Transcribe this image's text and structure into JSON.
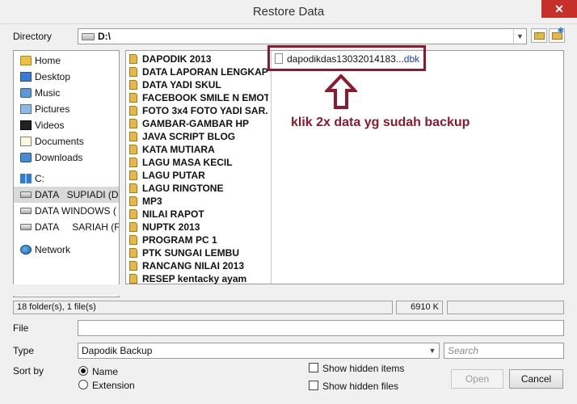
{
  "window": {
    "title": "Restore Data",
    "close_glyph": "✕"
  },
  "directory": {
    "label": "Directory",
    "path": "D:\\",
    "arrow_glyph": "▼"
  },
  "nav": {
    "items": [
      {
        "label": "Home",
        "icon": "home-icon"
      },
      {
        "label": "Desktop",
        "icon": "desktop-icon"
      },
      {
        "label": "Music",
        "icon": "music-icon"
      },
      {
        "label": "Pictures",
        "icon": "pictures-icon"
      },
      {
        "label": "Videos",
        "icon": "videos-icon"
      },
      {
        "label": "Documents",
        "icon": "documents-icon"
      },
      {
        "label": "Downloads",
        "icon": "downloads-icon"
      },
      {
        "label": "C:",
        "icon": "windows-drive-icon"
      },
      {
        "label": "DATA   SUPIADI (D",
        "icon": "drive-icon",
        "selected": true
      },
      {
        "label": "DATA WINDOWS (",
        "icon": "drive-icon"
      },
      {
        "label": "DATA     SARIAH (F",
        "icon": "drive-icon"
      },
      {
        "label": "Network",
        "icon": "network-icon"
      }
    ]
  },
  "folders": [
    "DAPODIK 2013",
    "DATA LAPORAN LENGKAP",
    "DATA YADI SKUL",
    "FACEBOOK SMILE N EMOT...",
    "FOTO 3x4 FOTO YADI SAR...",
    "GAMBAR-GAMBAR HP",
    "JAVA SCRIPT BLOG",
    "KATA MUTIARA",
    "LAGU MASA KECIL",
    "LAGU PUTAR",
    "LAGU RINGTONE",
    "MP3",
    "NILAI RAPOT",
    "NUPTK 2013",
    "PROGRAM PC 1",
    "PTK SUNGAI LEMBU",
    "RANCANG NILAI 2013",
    "RESEP kentacky ayam"
  ],
  "file": {
    "name": "dapodikdas13032014183...",
    "ext": "dbk"
  },
  "annotation": {
    "text": "klik 2x data yg sudah backup",
    "color": "#8b1a2e"
  },
  "status": {
    "summary": "18 folder(s), 1 file(s)",
    "size": "6910 K"
  },
  "form": {
    "file_label": "File",
    "file_value": "",
    "type_label": "Type",
    "type_value": "Dapodik Backup",
    "search_placeholder": "Search",
    "sortby_label": "Sort by",
    "sort_name": "Name",
    "sort_extension": "Extension",
    "show_hidden_items": "Show hidden items",
    "show_hidden_files": "Show hidden files"
  },
  "buttons": {
    "open": "Open",
    "cancel": "Cancel"
  }
}
